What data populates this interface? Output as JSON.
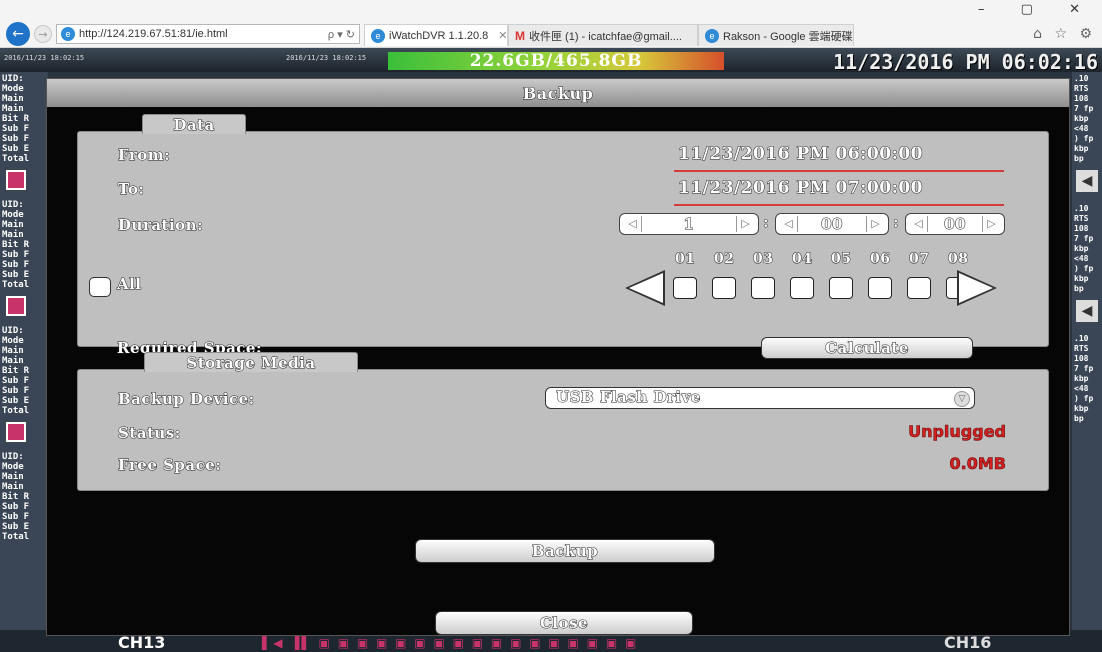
{
  "browser": {
    "url": "http://124.219.67.51:81/ie.html",
    "addr_tools": "ρ ▾ ↻",
    "tabs": [
      {
        "label": "iWatchDVR 1.1.20.8",
        "active": true
      },
      {
        "label": "收件匣 (1) - icatchfae@gmail....",
        "active": false
      },
      {
        "label": "Rakson - Google 雲端硬碟",
        "active": false
      }
    ],
    "window_controls": "– ▢ ✕",
    "right_icons": "⌂ ☆ ⚙"
  },
  "dvr": {
    "storage": "22.6GB/465.8GB",
    "datetime": "11/23/2016 PM 06:02:16",
    "cam_timestamps": [
      "2016/11/23 18:02:15",
      "2016/11/23 18:02:15"
    ],
    "info_lines": "UID:\nMode\nMain\nMain\nBit R\nSub F\nSub F\nSub E\nTotal",
    "right_lines": ".10\nRTS\n108\n7 fp\nkbp\n<48\n) fp\nkbp\nbp",
    "channel_left": "CH13",
    "channel_right": "CH16",
    "control_row": "▌◀ ▐▌ ▣ ▣ ▣ ▣ ▣ ▣ ▣ ▣ ▣ ▣ ▣ ▣ ▣ ▣ ▣ ▣ ▣"
  },
  "modal": {
    "title": "Backup",
    "data_section": {
      "legend": "Data",
      "from_label": "From:",
      "from_value": "11/23/2016 PM 06:00:00",
      "to_label": "To:",
      "to_value": "11/23/2016 PM 07:00:00",
      "duration_label": "Duration:",
      "duration": {
        "hours": "1",
        "minutes": "00",
        "seconds": "00"
      },
      "channels": [
        "01",
        "02",
        "03",
        "04",
        "05",
        "06",
        "07",
        "08"
      ],
      "all_label": "All",
      "required_space_label": "Required Space:",
      "calculate_label": "Calculate"
    },
    "storage_section": {
      "legend": "Storage Media",
      "device_label": "Backup Device:",
      "device_value": "USB Flash Drive",
      "status_label": "Status:",
      "status_value": "Unplugged",
      "free_space_label": "Free Space:",
      "free_space_value": "0.0MB"
    },
    "backup_label": "Backup",
    "close_label": "Close"
  },
  "colors": {
    "status_red": "#d42020",
    "date_underline": "#d23c3c",
    "panel_bg": "#bfbfbf"
  }
}
